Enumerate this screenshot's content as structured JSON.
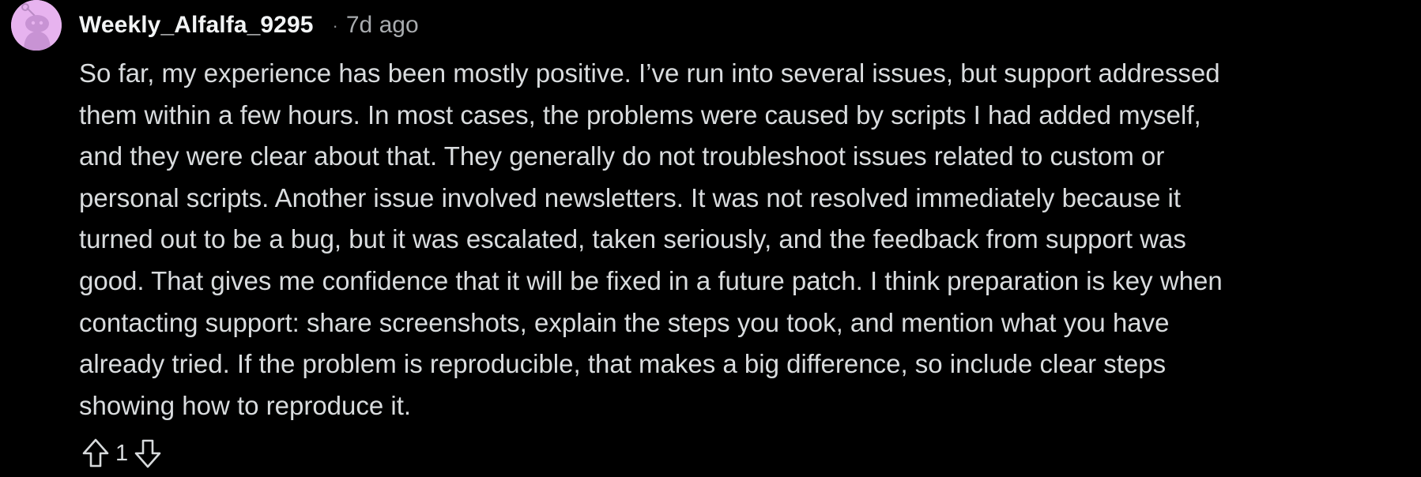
{
  "comment": {
    "username": "Weekly_Alfalfa_9295",
    "separator": "·",
    "age": "7d ago",
    "avatar_icon": "reddit-snoo-avatar",
    "avatar_color": "#e7b3ef",
    "lines": [
      "So far, my experience has been mostly positive. I’ve run into several issues, but support addressed",
      "them within a few hours. In most cases, the problems were caused by scripts I had added myself,",
      "and they were clear about that. They generally do not troubleshoot issues related to custom or",
      "personal scripts. Another issue involved newsletters. It was not resolved immediately because it",
      "turned out to be a bug, but it was escalated, taken seriously, and the feedback from support was",
      "good. That gives me confidence that it will be fixed in a future patch. I think preparation is key when",
      "contacting support: share screenshots, explain the steps you took, and mention what you have",
      "already tried. If the problem is reproducible, that makes a big difference, so include clear steps",
      "showing how to reproduce it."
    ],
    "votes": {
      "count": "1",
      "upvote_icon": "upvote-arrow-icon",
      "downvote_icon": "downvote-arrow-icon"
    }
  },
  "colors": {
    "background": "#000000",
    "text": "#d9dcde",
    "meta": "#a8abae"
  }
}
